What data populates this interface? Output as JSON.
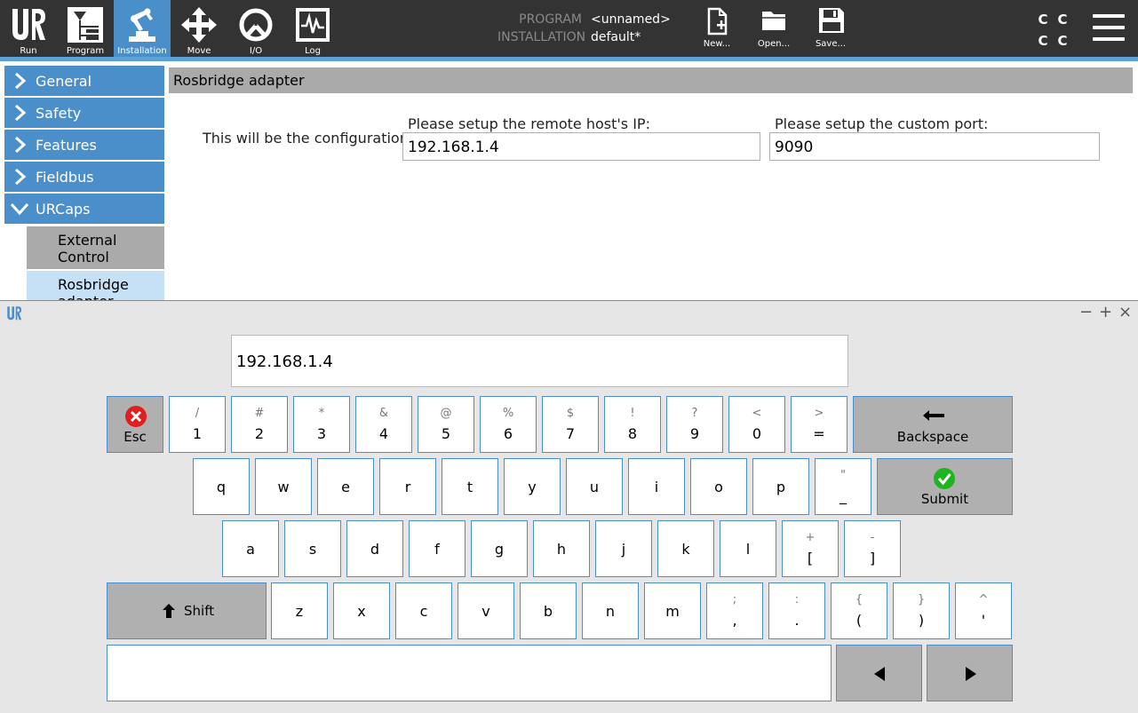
{
  "topbar": {
    "nav": [
      {
        "label": "Run",
        "icon": "ur-logo-icon"
      },
      {
        "label": "Program",
        "icon": "program-icon"
      },
      {
        "label": "Installation",
        "icon": "robot-arm-icon"
      },
      {
        "label": "Move",
        "icon": "move-arrows-icon"
      },
      {
        "label": "I/O",
        "icon": "io-icon"
      },
      {
        "label": "Log",
        "icon": "log-icon"
      }
    ],
    "program_key": "PROGRAM",
    "program_val": "<unnamed>",
    "installation_key": "INSTALLATION",
    "installation_val": "default*",
    "file": [
      {
        "label": "New...",
        "icon": "new-file-icon"
      },
      {
        "label": "Open...",
        "icon": "open-folder-icon"
      },
      {
        "label": "Save...",
        "icon": "save-disk-icon"
      }
    ],
    "speed": [
      "C",
      "C",
      "C",
      "C"
    ],
    "accent_color": "#4a8fca"
  },
  "sidebar": {
    "items": [
      {
        "label": "General"
      },
      {
        "label": "Safety"
      },
      {
        "label": "Features"
      },
      {
        "label": "Fieldbus"
      },
      {
        "label": "URCaps"
      }
    ],
    "subitems": [
      {
        "label": "External Control"
      },
      {
        "label": "Rosbridge adapter"
      }
    ]
  },
  "main": {
    "title": "Rosbridge adapter",
    "config_text": "This will be the configuration",
    "ip_label": "Please setup the remote host's IP:",
    "ip_value": "192.168.1.4",
    "port_label": "Please setup the custom port:",
    "port_value": "9090"
  },
  "keyboard": {
    "display_value": "192.168.1.4",
    "esc_label": "Esc",
    "backspace_label": "Backspace",
    "submit_label": "Submit",
    "shift_label": "Shift",
    "row1": [
      {
        "alt": "/",
        "main": "1"
      },
      {
        "alt": "#",
        "main": "2"
      },
      {
        "alt": "*",
        "main": "3"
      },
      {
        "alt": "&",
        "main": "4"
      },
      {
        "alt": "@",
        "main": "5"
      },
      {
        "alt": "%",
        "main": "6"
      },
      {
        "alt": "$",
        "main": "7"
      },
      {
        "alt": "!",
        "main": "8"
      },
      {
        "alt": "?",
        "main": "9"
      },
      {
        "alt": "<",
        "main": "0"
      },
      {
        "alt": ">",
        "main": "="
      }
    ],
    "row2": [
      {
        "main": "q"
      },
      {
        "main": "w"
      },
      {
        "main": "e"
      },
      {
        "main": "r"
      },
      {
        "main": "t"
      },
      {
        "main": "y"
      },
      {
        "main": "u"
      },
      {
        "main": "i"
      },
      {
        "main": "o"
      },
      {
        "main": "p"
      },
      {
        "alt": "\"",
        "main": "_"
      }
    ],
    "row3": [
      {
        "main": "a"
      },
      {
        "main": "s"
      },
      {
        "main": "d"
      },
      {
        "main": "f"
      },
      {
        "main": "g"
      },
      {
        "main": "h"
      },
      {
        "main": "j"
      },
      {
        "main": "k"
      },
      {
        "main": "l"
      },
      {
        "alt": "+",
        "main": "["
      },
      {
        "alt": "-",
        "main": "]"
      }
    ],
    "row4": [
      {
        "main": "z"
      },
      {
        "main": "x"
      },
      {
        "main": "c"
      },
      {
        "main": "v"
      },
      {
        "main": "b"
      },
      {
        "main": "n"
      },
      {
        "main": "m"
      },
      {
        "alt": ";",
        "main": ","
      },
      {
        "alt": ":",
        "main": "."
      },
      {
        "alt": "{",
        "main": "("
      },
      {
        "alt": "}",
        "main": ")"
      },
      {
        "alt": "^",
        "main": "'"
      }
    ]
  }
}
